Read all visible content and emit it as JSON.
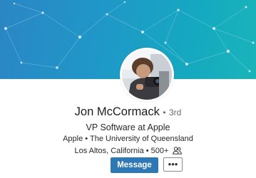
{
  "profile": {
    "name": "Jon McCormack",
    "degree": "3rd",
    "degree_separator": "•",
    "headline": "VP Software at Apple",
    "company": "Apple",
    "separator": "•",
    "education": "The University of Queensland",
    "location": "Los Altos, California",
    "connections": "500+",
    "connections_icon": "people-icon"
  },
  "actions": {
    "message_label": "Message",
    "more_label": "•••"
  },
  "colors": {
    "banner_start": "#2b86c4",
    "banner_end": "#19b4ba",
    "message_button": "#2f78b6"
  }
}
